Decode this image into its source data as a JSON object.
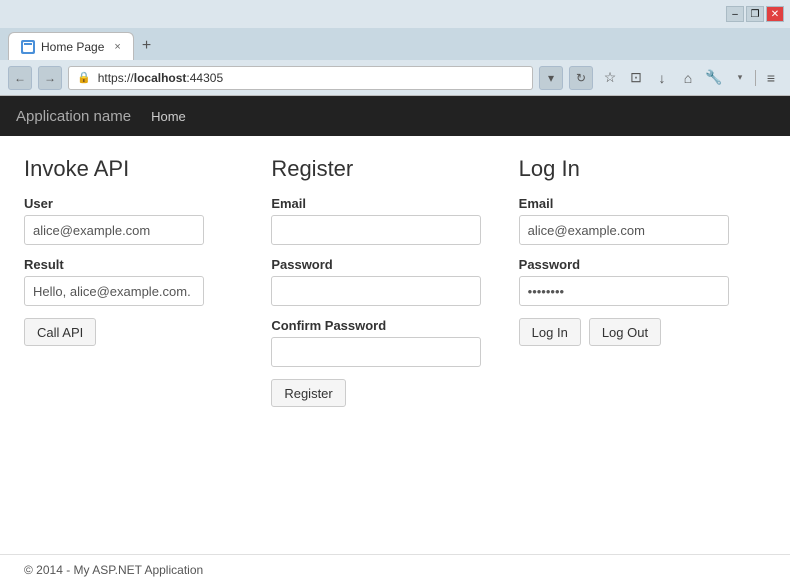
{
  "browser": {
    "title_bar": {
      "minimize_label": "–",
      "restore_label": "❐",
      "close_label": "✕"
    },
    "tab": {
      "label": "Home Page",
      "close": "×",
      "new_tab": "+"
    },
    "address": {
      "back": "←",
      "forward": "→",
      "url_protocol": "https://",
      "url_host": "localhost",
      "url_port": ":44305",
      "refresh": "↻",
      "dropdown": "▾"
    },
    "toolbar": {
      "star": "☆",
      "clipboard": "⊡",
      "download": "↓",
      "home": "⌂",
      "extensions": "🔧",
      "menu": "≡"
    }
  },
  "navbar": {
    "brand": "Application name",
    "links": [
      {
        "label": "Home"
      }
    ]
  },
  "invoke_api": {
    "title": "Invoke API",
    "user_label": "User",
    "user_value": "alice@example.com",
    "result_label": "Result",
    "result_value": "Hello, alice@example.com.",
    "call_button": "Call API"
  },
  "register": {
    "title": "Register",
    "email_label": "Email",
    "email_value": "",
    "email_placeholder": "",
    "password_label": "Password",
    "password_value": "",
    "confirm_label": "Confirm Password",
    "confirm_value": "",
    "register_button": "Register"
  },
  "login": {
    "title": "Log In",
    "email_label": "Email",
    "email_value": "alice@example.com",
    "password_label": "Password",
    "password_value": "••••••••",
    "login_button": "Log In",
    "logout_button": "Log Out"
  },
  "footer": {
    "text": "© 2014 - My ASP.NET Application"
  }
}
